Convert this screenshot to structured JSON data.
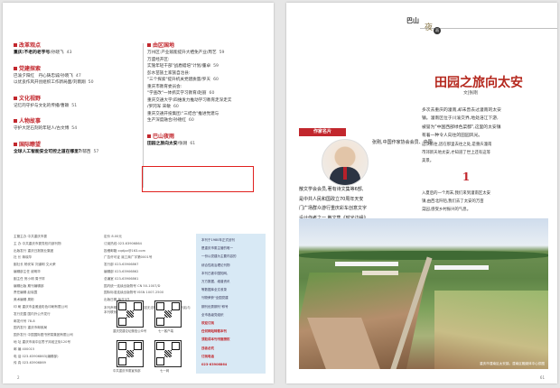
{
  "toc": {
    "left_sections": [
      {
        "heading": "改革观点",
        "entries": [
          {
            "title": "重庆:不老的老字号",
            "author": "/孙晓飞",
            "page": "43",
            "bold": true
          }
        ]
      },
      {
        "heading": "党建探索",
        "entries": [
          {
            "title": "巴渝夕阳红　丹心铸忠诚",
            "author": "/孙晓飞",
            "page": "47",
            "bold": false
          },
          {
            "title": "以优良作风开创组织工作新局面",
            "author": "/刘雨翔",
            "page": "50",
            "bold": false
          }
        ]
      },
      {
        "heading": "文化视野",
        "entries": [
          {
            "title": "记忆的守护与文化的传播",
            "author": "/曹颖",
            "page": "51",
            "bold": false
          }
        ]
      },
      {
        "heading": "人物故事",
        "entries": [
          {
            "title": "守护大足石刻的年轻人",
            "author": "/古文博",
            "page": "54",
            "bold": false
          }
        ]
      },
      {
        "heading": "国际瞭望",
        "entries": [
          {
            "title": "全球人工智能安全可控之道在哪里?",
            "author": "/郁西",
            "page": "57",
            "bold": true
          }
        ]
      }
    ],
    "right_sections": [
      {
        "heading": "由区国地",
        "entries": [
          {
            "title": "万州区:产业赋能提升大栖免产业",
            "author": "/周艺",
            "page": "59",
            "bold": false
          },
          {
            "title": "万盛经开区:",
            "author": "",
            "page": "",
            "bold": false
          },
          {
            "title": "实施年轻干部\"战盾蜡培\"计划",
            "author": "/董卓",
            "page": "59",
            "bold": false
          },
          {
            "title": "彭水苗族土家族自治县:",
            "author": "",
            "page": "",
            "bold": false
          },
          {
            "title": "\"三个探索\"提升机关党建质量",
            "author": "/罗天",
            "page": "60",
            "bold": false
          },
          {
            "title": "重庆市教育委员会:",
            "author": "",
            "page": "",
            "bold": false
          },
          {
            "title": "\"学查改\"一体抓实学习教育",
            "author": "/赵丽",
            "page": "60",
            "bold": false
          },
          {
            "title": "重庆交通大学:四维发力推动学习教育走深走实",
            "author": "",
            "page": "",
            "bold": false
          },
          {
            "title": "/罗冈军 宋敏",
            "author": "",
            "page": "60",
            "bold": false
          },
          {
            "title": "重庆交通开投集团:\"三结合\"推进党建与",
            "author": "",
            "page": "",
            "bold": false
          },
          {
            "title": "生产深度融合",
            "author": "/孙德红",
            "page": "60",
            "bold": false
          }
        ]
      },
      {
        "heading": "巴山夜雨",
        "entries": [
          {
            "title": "田园之旅向太安",
            "author": "/张刚",
            "page": "61",
            "bold": true
          }
        ]
      }
    ]
  },
  "imprint": {
    "col1": [
      "主管主办 中共重庆市委",
      "主 办 中共重庆市委党校内部刊物",
      "出版发行 重庆日报报业集团",
      "社 长 蒋晓华",
      "副社长 杨安军 刘道明 文大荣",
      "编辑部主任 谢明华",
      "副主任 贺小明 周子祥",
      "编辑出版 期刊编辑部",
      "责任编辑 赵晓霞",
      "美术编辑 周彬",
      "印 刷 重庆市金雅迪彩色印刷有限公司",
      "发行范围 国内外公开发行",
      "邮发代号 78-8",
      "国内发行 重庆市邮政局",
      "国外发行 中国国际图书贸易集团有限公司",
      "地 址 重庆市渝中区枣子岚垭正街120号",
      "邮 编 400015",
      "电 话 023-63906863(编辑部)",
      "传 真 023-63906869"
    ],
    "col2": [
      "定价 8.00元",
      "订阅热线 023-63906864",
      "投稿邮箱 cqdjzz@163.com",
      "广告许可证 渝工商广字第0001号",
      "发行部 023-63906867",
      "编辑部 023-63906862",
      "总编室 023-63906861",
      "国内统一连续出版物号 CN 50-1007/D",
      "国际标准连续出版物号 ISSN 1007-2500",
      "出版日期 每月5日",
      "本刊声明 本刊所用部分图片因无法联系作者,请作者见刊后与本刊联系,以便支付稿酬。"
    ],
    "qr_captions": [
      "重庆党建论坛微信公众号",
      "七一客户端",
      "中共重庆市委宣传部",
      "七一网"
    ],
    "ad_lines": [
      "本刊于1980年正式创刊",
      "是重庆市委主管的唯一",
      "一份以党建为主要内容的",
      "综合性政治理论刊物",
      "本刊已被中国知网、",
      "万方数据、维普资讯",
      "等数据库全文收录",
      "刊物荣获\"全国党建",
      "期刊优秀期刊\"称号",
      "全市各级党组织",
      "欢迎订阅",
      "任何网站转载本刊",
      "须取得本刊书面授权",
      "违者必究",
      "订阅电话",
      "023-63906864"
    ],
    "folio": "2"
  },
  "article": {
    "column_logo": "巴山",
    "column_logo2": "夜",
    "column_logo3": "雨",
    "title": "田园之旅向太安",
    "byline": "文|张刚",
    "author_badge": "作家名片",
    "bio": [
      "张刚,中国作家协会会员、中国",
      "散文学会会员,著有诗文集等6部,",
      "是中共人民和国政立70周年天安",
      "门广场群众游行重庆彩车创意文字",
      "设计作者之一,散文集《时光边缘》",
      "获第十届冰心散文奖。"
    ],
    "intro": [
      "多次去重庆的潼南,却未曾去过潼南的太安",
      "镇。潼南区位于川渝交界,地处涪江下游,",
      "被誉为\"中国西部绿色菜都\",这里的太安镇",
      "有着一种令人向往的田园风光。",
      "这次前往,因在那里去往之处,是重庆潼南",
      "市郊新天地太安,才知道了世上还有这等",
      "美景。"
    ],
    "section_num": "1",
    "para2": [
      "入夏后的一个周末,我们来到潼南区太安",
      "镇,由西北阡陌,我们去了太安的万亩",
      "菜园,感受乡村振兴的气息。"
    ],
    "photo_caption": "重庆市潼南区太安镇。潼南区融媒体中心供图",
    "folio": "61"
  }
}
